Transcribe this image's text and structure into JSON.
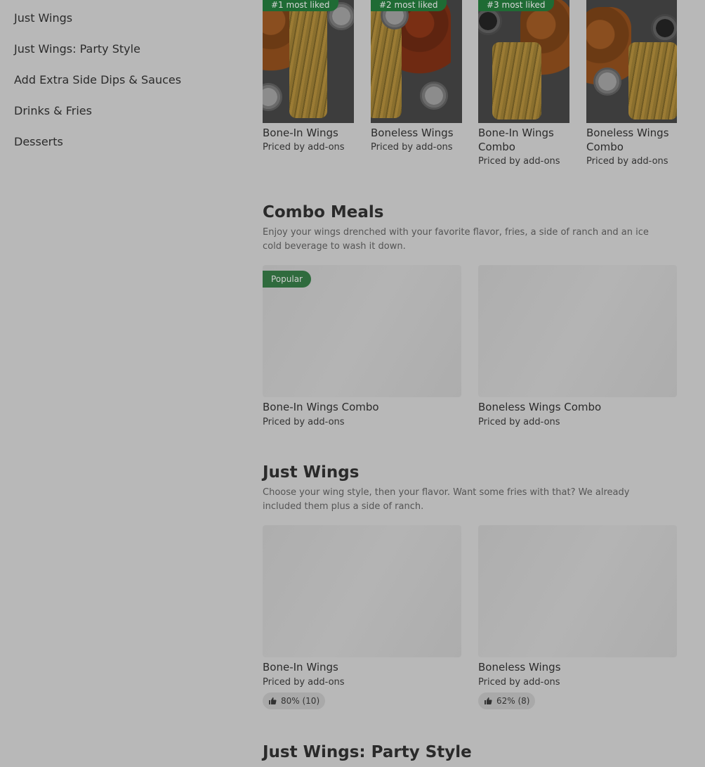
{
  "sidebar": {
    "items": [
      {
        "label": "Just Wings"
      },
      {
        "label": "Just Wings: Party Style"
      },
      {
        "label": "Add Extra Side Dips & Sauces"
      },
      {
        "label": "Drinks & Fries"
      },
      {
        "label": "Desserts"
      }
    ]
  },
  "carousel": {
    "items": [
      {
        "badge": "#1 most liked",
        "title": "Bone-In Wings",
        "subtitle": "Priced by add-ons"
      },
      {
        "badge": "#2 most liked",
        "title": "Boneless Wings",
        "subtitle": "Priced by add-ons"
      },
      {
        "badge": "#3 most liked",
        "title": "Bone-In Wings Combo",
        "subtitle": "Priced by add-ons"
      },
      {
        "badge": "",
        "title": "Boneless Wings Combo",
        "subtitle": "Priced by add-ons"
      }
    ]
  },
  "combo": {
    "title": "Combo Meals",
    "description": "Enjoy your wings drenched with your favorite flavor, fries, a side of ranch and an ice cold beverage to wash it down.",
    "items": [
      {
        "badge": "Popular",
        "title": "Bone-In Wings Combo",
        "subtitle": "Priced by add-ons"
      },
      {
        "title": "Boneless Wings Combo",
        "subtitle": "Priced by add-ons"
      }
    ]
  },
  "just_wings": {
    "title": "Just Wings",
    "description": "Choose your wing style, then your flavor. Want some fries with that? We already included them plus a side of ranch.",
    "items": [
      {
        "title": "Bone-In Wings",
        "subtitle": "Priced by add-ons",
        "rating": "80% (10)"
      },
      {
        "title": "Boneless Wings",
        "subtitle": "Priced by add-ons",
        "rating": "62% (8)"
      }
    ]
  },
  "party": {
    "title": "Just Wings: Party Style"
  },
  "icons": {
    "rating": "thumbs-up-icon"
  },
  "colors": {
    "badge_green": "#1f6b34",
    "overlay_bg": "#b8b8b8"
  }
}
